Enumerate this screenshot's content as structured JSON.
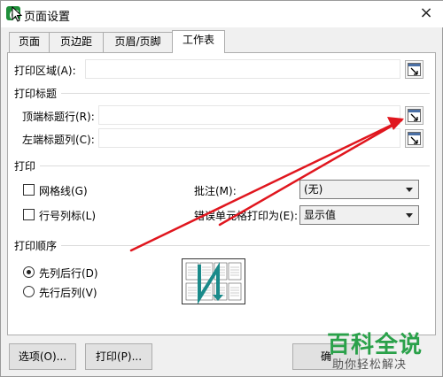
{
  "window": {
    "title": "页面设置",
    "close_glyph": "×"
  },
  "tabs": [
    {
      "label": "页面"
    },
    {
      "label": "页边距"
    },
    {
      "label": "页眉/页脚"
    },
    {
      "label": "工作表"
    }
  ],
  "print_area": {
    "label": "打印区域(A):",
    "value": ""
  },
  "print_titles": {
    "section": "打印标题",
    "top_rows": {
      "label": "顶端标题行(R):",
      "value": ""
    },
    "left_cols": {
      "label": "左端标题列(C):",
      "value": ""
    }
  },
  "print": {
    "section": "打印",
    "gridlines": {
      "label": "网格线(G)",
      "checked": false
    },
    "row_col_headers": {
      "label": "行号列标(L)",
      "checked": false
    },
    "comments": {
      "label": "批注(M):",
      "value": "(无)"
    },
    "cell_errors": {
      "label": "错误单元格打印为(E):",
      "value": "显示值"
    }
  },
  "print_order": {
    "section": "打印顺序",
    "down_then_over": {
      "label": "先列后行(D)",
      "selected": true
    },
    "over_then_down": {
      "label": "先行后列(V)",
      "selected": false
    }
  },
  "buttons": {
    "options": "选项(O)...",
    "print": "打印(P)...",
    "ok": "确"
  },
  "watermark": {
    "title": "百科全说",
    "subtitle": "助你轻松解决"
  },
  "colors": {
    "annotation_arrow": "#e0161e",
    "brand_green": "#2aa14a"
  }
}
